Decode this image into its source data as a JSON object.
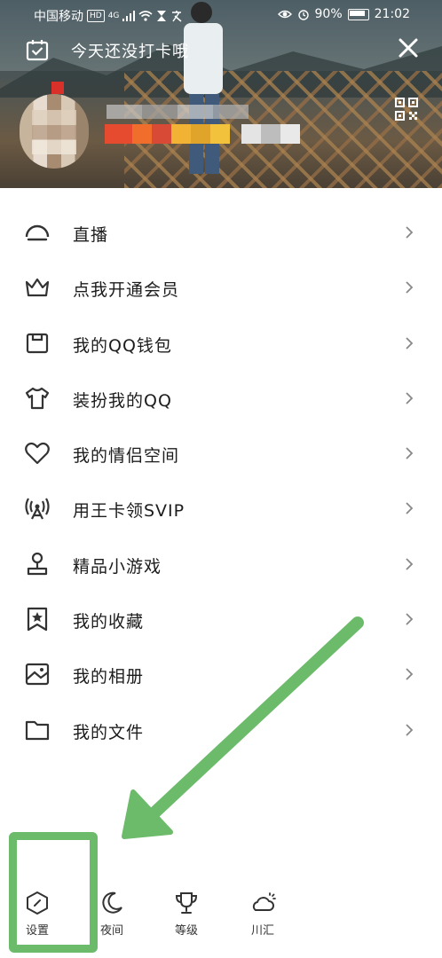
{
  "status_bar": {
    "carrier": "中国移动",
    "hd": "HD",
    "network": "4G",
    "battery": "90%",
    "time": "21:02"
  },
  "header": {
    "checkin_text": "今天还没打卡哦"
  },
  "menu": {
    "items": [
      {
        "label": "直播",
        "icon": "live-icon"
      },
      {
        "label": "点我开通会员",
        "icon": "crown-icon"
      },
      {
        "label": "我的QQ钱包",
        "icon": "wallet-icon"
      },
      {
        "label": "装扮我的QQ",
        "icon": "shirt-icon"
      },
      {
        "label": "我的情侣空间",
        "icon": "heart-icon"
      },
      {
        "label": "用王卡领SVIP",
        "icon": "antenna-icon"
      },
      {
        "label": "精品小游戏",
        "icon": "joystick-icon"
      },
      {
        "label": "我的收藏",
        "icon": "star-bookmark-icon"
      },
      {
        "label": "我的相册",
        "icon": "photo-album-icon"
      },
      {
        "label": "我的文件",
        "icon": "folder-icon"
      }
    ]
  },
  "bottom_bar": {
    "settings": "设置",
    "night": "夜间",
    "level": "等级",
    "weather": "川汇"
  },
  "colors": {
    "highlight": "#6cbb6b",
    "icon_stroke": "#333333"
  }
}
